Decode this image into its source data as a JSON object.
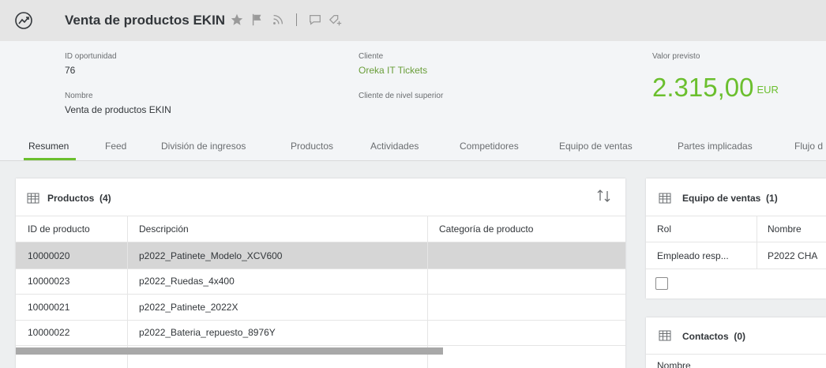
{
  "title": "Venta de productos EKIN",
  "header": {
    "id_label": "ID oportunidad",
    "id_value": "76",
    "name_label": "Nombre",
    "name_value": "Venta de productos EKIN",
    "client_label": "Cliente",
    "client_value": "Oreka IT Tickets",
    "parent_client_label": "Cliente de nivel superior",
    "expected_label": "Valor previsto",
    "expected_value": "2.315,00",
    "expected_currency": "EUR"
  },
  "tabs": [
    {
      "label": "Resumen",
      "active": true
    },
    {
      "label": "Feed"
    },
    {
      "label": "División de ingresos"
    },
    {
      "label": "Productos"
    },
    {
      "label": "Actividades"
    },
    {
      "label": "Competidores"
    },
    {
      "label": "Equipo de ventas"
    },
    {
      "label": "Partes implicadas"
    },
    {
      "label": "Flujo d"
    }
  ],
  "products": {
    "title": "Productos",
    "count": "(4)",
    "columns": [
      "ID de producto",
      "Descripción",
      "Categoría de producto"
    ],
    "rows": [
      {
        "id": "10000020",
        "desc": "p2022_Patinete_Modelo_XCV600",
        "cat": "",
        "selected": true
      },
      {
        "id": "10000023",
        "desc": "p2022_Ruedas_4x400",
        "cat": ""
      },
      {
        "id": "10000021",
        "desc": "p2022_Patinete_2022X",
        "cat": ""
      },
      {
        "id": "10000022",
        "desc": "p2022_Bateria_repuesto_8976Y",
        "cat": ""
      }
    ]
  },
  "sales_team": {
    "title": "Equipo de ventas",
    "count": "(1)",
    "columns": [
      "Rol",
      "Nombre"
    ],
    "rows": [
      {
        "role": "Empleado resp...",
        "name": "P2022 CHA"
      }
    ]
  },
  "contacts": {
    "title": "Contactos",
    "count": "(0)",
    "columns": [
      "Nombre"
    ]
  },
  "colors": {
    "accent": "#6bbf2e",
    "link": "#6a9e3a"
  },
  "icons": [
    "app-icon",
    "star-icon",
    "flag-icon",
    "rss-icon",
    "comment-icon",
    "tag-add-icon",
    "grid-icon",
    "sort-icon"
  ]
}
